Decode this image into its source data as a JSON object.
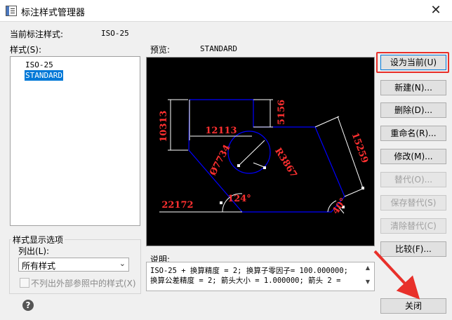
{
  "window": {
    "title": "标注样式管理器",
    "close_glyph": "✕"
  },
  "current_style": {
    "label": "当前标注样式:",
    "value": "ISO-25"
  },
  "styles": {
    "label": "样式(S):",
    "items": [
      "ISO-25",
      "STANDARD"
    ],
    "selected": "STANDARD"
  },
  "preview": {
    "label": "预览:",
    "style_name": "STANDARD",
    "dimensions": {
      "d1": "10313",
      "d2": "12113",
      "d3": "5156",
      "d4": "15259",
      "d5": "Ø7734",
      "d6": "R3867",
      "d7": "22172",
      "d8": "124°",
      "d9": "40°"
    },
    "colors": {
      "outline": "#0000ff",
      "dimension": "#ff0000",
      "extension": "#ffffff"
    }
  },
  "display_options": {
    "group_title": "样式显示选项",
    "list_label": "列出(L):",
    "list_value": "所有样式",
    "exclude_xref_label": "不列出外部参照中的样式(X)"
  },
  "description": {
    "label": "说明:",
    "lines": [
      "ISO-25 + 换算精度 = 2; 换算子零因子= 100.000000;",
      "换算公差精度 = 2; 箭头大小  = 1.000000; 箭头 2 ="
    ]
  },
  "buttons": {
    "set_current": "设为当前(U)",
    "new": "新建(N)...",
    "delete": "删除(D)...",
    "rename": "重命名(R)...",
    "modify": "修改(M)...",
    "override": "替代(O)...",
    "save_override": "保存替代(S)",
    "clear_override": "清除替代(C)",
    "compare": "比较(F)...",
    "close": "关闭"
  },
  "help": {
    "glyph": "?"
  },
  "annotation": {
    "color": "#e8302a"
  }
}
